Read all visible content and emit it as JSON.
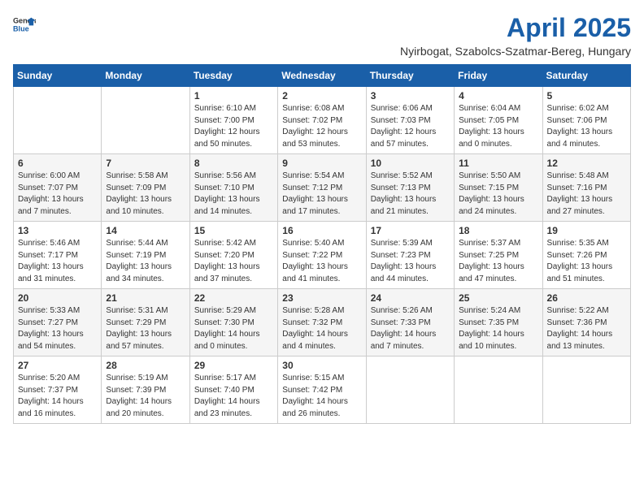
{
  "logo": {
    "general": "General",
    "blue": "Blue"
  },
  "title": "April 2025",
  "location": "Nyirbogat, Szabolcs-Szatmar-Bereg, Hungary",
  "days_header": [
    "Sunday",
    "Monday",
    "Tuesday",
    "Wednesday",
    "Thursday",
    "Friday",
    "Saturday"
  ],
  "weeks": [
    [
      {
        "day": "",
        "info": ""
      },
      {
        "day": "",
        "info": ""
      },
      {
        "day": "1",
        "info": "Sunrise: 6:10 AM\nSunset: 7:00 PM\nDaylight: 12 hours and 50 minutes."
      },
      {
        "day": "2",
        "info": "Sunrise: 6:08 AM\nSunset: 7:02 PM\nDaylight: 12 hours and 53 minutes."
      },
      {
        "day": "3",
        "info": "Sunrise: 6:06 AM\nSunset: 7:03 PM\nDaylight: 12 hours and 57 minutes."
      },
      {
        "day": "4",
        "info": "Sunrise: 6:04 AM\nSunset: 7:05 PM\nDaylight: 13 hours and 0 minutes."
      },
      {
        "day": "5",
        "info": "Sunrise: 6:02 AM\nSunset: 7:06 PM\nDaylight: 13 hours and 4 minutes."
      }
    ],
    [
      {
        "day": "6",
        "info": "Sunrise: 6:00 AM\nSunset: 7:07 PM\nDaylight: 13 hours and 7 minutes."
      },
      {
        "day": "7",
        "info": "Sunrise: 5:58 AM\nSunset: 7:09 PM\nDaylight: 13 hours and 10 minutes."
      },
      {
        "day": "8",
        "info": "Sunrise: 5:56 AM\nSunset: 7:10 PM\nDaylight: 13 hours and 14 minutes."
      },
      {
        "day": "9",
        "info": "Sunrise: 5:54 AM\nSunset: 7:12 PM\nDaylight: 13 hours and 17 minutes."
      },
      {
        "day": "10",
        "info": "Sunrise: 5:52 AM\nSunset: 7:13 PM\nDaylight: 13 hours and 21 minutes."
      },
      {
        "day": "11",
        "info": "Sunrise: 5:50 AM\nSunset: 7:15 PM\nDaylight: 13 hours and 24 minutes."
      },
      {
        "day": "12",
        "info": "Sunrise: 5:48 AM\nSunset: 7:16 PM\nDaylight: 13 hours and 27 minutes."
      }
    ],
    [
      {
        "day": "13",
        "info": "Sunrise: 5:46 AM\nSunset: 7:17 PM\nDaylight: 13 hours and 31 minutes."
      },
      {
        "day": "14",
        "info": "Sunrise: 5:44 AM\nSunset: 7:19 PM\nDaylight: 13 hours and 34 minutes."
      },
      {
        "day": "15",
        "info": "Sunrise: 5:42 AM\nSunset: 7:20 PM\nDaylight: 13 hours and 37 minutes."
      },
      {
        "day": "16",
        "info": "Sunrise: 5:40 AM\nSunset: 7:22 PM\nDaylight: 13 hours and 41 minutes."
      },
      {
        "day": "17",
        "info": "Sunrise: 5:39 AM\nSunset: 7:23 PM\nDaylight: 13 hours and 44 minutes."
      },
      {
        "day": "18",
        "info": "Sunrise: 5:37 AM\nSunset: 7:25 PM\nDaylight: 13 hours and 47 minutes."
      },
      {
        "day": "19",
        "info": "Sunrise: 5:35 AM\nSunset: 7:26 PM\nDaylight: 13 hours and 51 minutes."
      }
    ],
    [
      {
        "day": "20",
        "info": "Sunrise: 5:33 AM\nSunset: 7:27 PM\nDaylight: 13 hours and 54 minutes."
      },
      {
        "day": "21",
        "info": "Sunrise: 5:31 AM\nSunset: 7:29 PM\nDaylight: 13 hours and 57 minutes."
      },
      {
        "day": "22",
        "info": "Sunrise: 5:29 AM\nSunset: 7:30 PM\nDaylight: 14 hours and 0 minutes."
      },
      {
        "day": "23",
        "info": "Sunrise: 5:28 AM\nSunset: 7:32 PM\nDaylight: 14 hours and 4 minutes."
      },
      {
        "day": "24",
        "info": "Sunrise: 5:26 AM\nSunset: 7:33 PM\nDaylight: 14 hours and 7 minutes."
      },
      {
        "day": "25",
        "info": "Sunrise: 5:24 AM\nSunset: 7:35 PM\nDaylight: 14 hours and 10 minutes."
      },
      {
        "day": "26",
        "info": "Sunrise: 5:22 AM\nSunset: 7:36 PM\nDaylight: 14 hours and 13 minutes."
      }
    ],
    [
      {
        "day": "27",
        "info": "Sunrise: 5:20 AM\nSunset: 7:37 PM\nDaylight: 14 hours and 16 minutes."
      },
      {
        "day": "28",
        "info": "Sunrise: 5:19 AM\nSunset: 7:39 PM\nDaylight: 14 hours and 20 minutes."
      },
      {
        "day": "29",
        "info": "Sunrise: 5:17 AM\nSunset: 7:40 PM\nDaylight: 14 hours and 23 minutes."
      },
      {
        "day": "30",
        "info": "Sunrise: 5:15 AM\nSunset: 7:42 PM\nDaylight: 14 hours and 26 minutes."
      },
      {
        "day": "",
        "info": ""
      },
      {
        "day": "",
        "info": ""
      },
      {
        "day": "",
        "info": ""
      }
    ]
  ]
}
